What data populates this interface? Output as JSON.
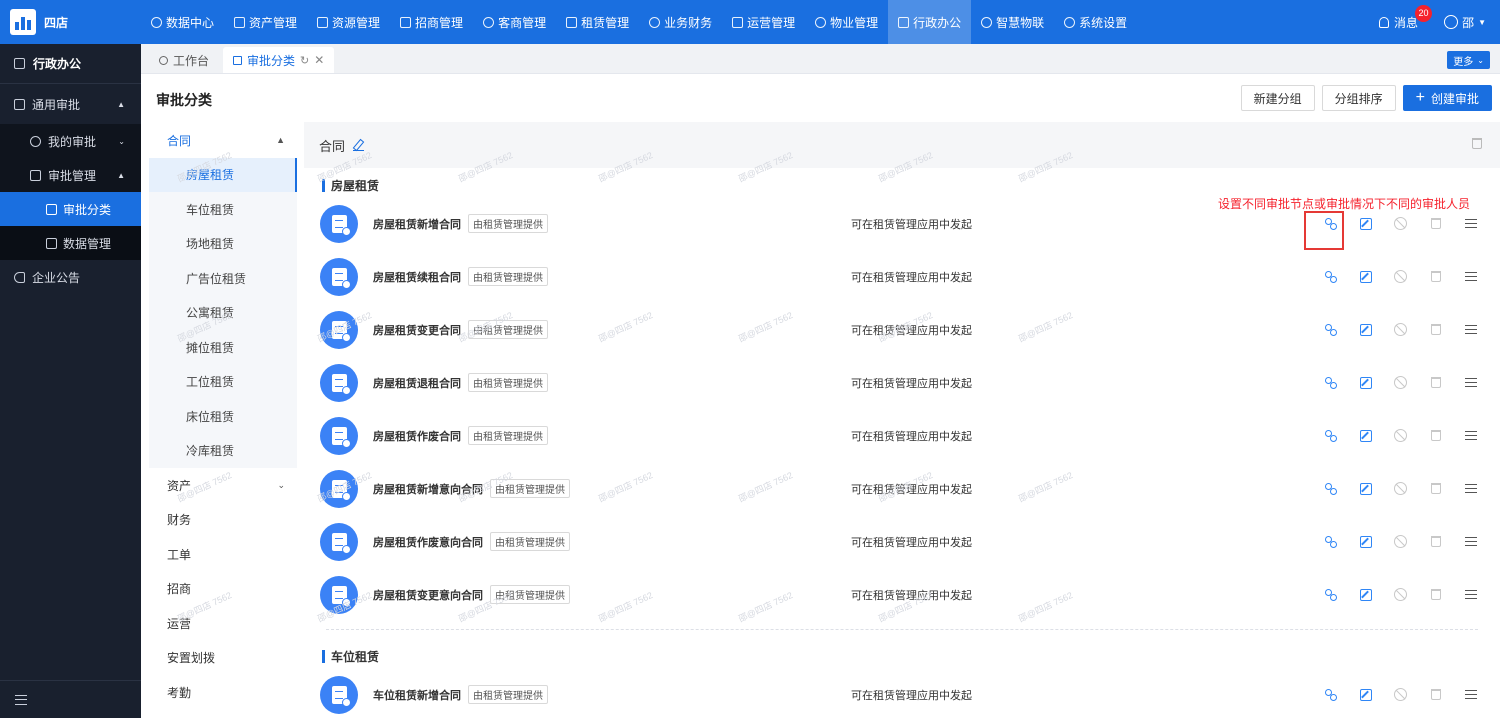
{
  "app": {
    "name": "四店"
  },
  "nav": [
    {
      "label": "数据中心",
      "icon": "dashboard-icon"
    },
    {
      "label": "资产管理",
      "icon": "cube-icon"
    },
    {
      "label": "资源管理",
      "icon": "building-icon"
    },
    {
      "label": "招商管理",
      "icon": "tag-icon"
    },
    {
      "label": "客商管理",
      "icon": "users-icon"
    },
    {
      "label": "租赁管理",
      "icon": "house-icon"
    },
    {
      "label": "业务财务",
      "icon": "yuan-icon"
    },
    {
      "label": "运营管理",
      "icon": "chart-icon"
    },
    {
      "label": "物业管理",
      "icon": "property-icon"
    },
    {
      "label": "行政办公",
      "icon": "monitor-icon",
      "active": true
    },
    {
      "label": "智慧物联",
      "icon": "iot-icon"
    },
    {
      "label": "系统设置",
      "icon": "gear-icon"
    }
  ],
  "topright": {
    "msg_label": "消息",
    "msg_count": "20",
    "user_name": "邵"
  },
  "sidebar": {
    "title": "行政办公",
    "groups": [
      {
        "label": "通用审批"
      },
      {
        "label": "我的审批"
      },
      {
        "label": "审批管理"
      },
      {
        "label": "审批分类"
      },
      {
        "label": "数据管理"
      },
      {
        "label": "企业公告"
      }
    ]
  },
  "tabs": [
    {
      "label": "工作台"
    },
    {
      "label": "审批分类"
    }
  ],
  "more_label": "更多",
  "page": {
    "title": "审批分类",
    "buttons": {
      "new_group": "新建分组",
      "sort_group": "分组排序",
      "create": "创建审批"
    }
  },
  "categories": {
    "top": "合同",
    "sub": [
      "房屋租赁",
      "车位租赁",
      "场地租赁",
      "广告位租赁",
      "公寓租赁",
      "摊位租赁",
      "工位租赁",
      "床位租赁",
      "冷库租赁"
    ],
    "others": [
      "资产",
      "财务",
      "工单",
      "招商",
      "运营",
      "安置划拨",
      "考勤"
    ]
  },
  "panel": {
    "title": "合同",
    "section1": "房屋租赁",
    "section2": "车位租赁",
    "provider_tag": "由租赁管理提供",
    "desc": "可在租赁管理应用中发起",
    "rows": [
      "房屋租赁新增合同",
      "房屋租赁续租合同",
      "房屋租赁变更合同",
      "房屋租赁退租合同",
      "房屋租赁作废合同",
      "房屋租赁新增意向合同",
      "房屋租赁作废意向合同",
      "房屋租赁变更意向合同"
    ],
    "row_s2": "车位租赁新增合同"
  },
  "annotation": "设置不同审批节点或审批情况下不同的审批人员",
  "watermark": "邵@四店 7562"
}
